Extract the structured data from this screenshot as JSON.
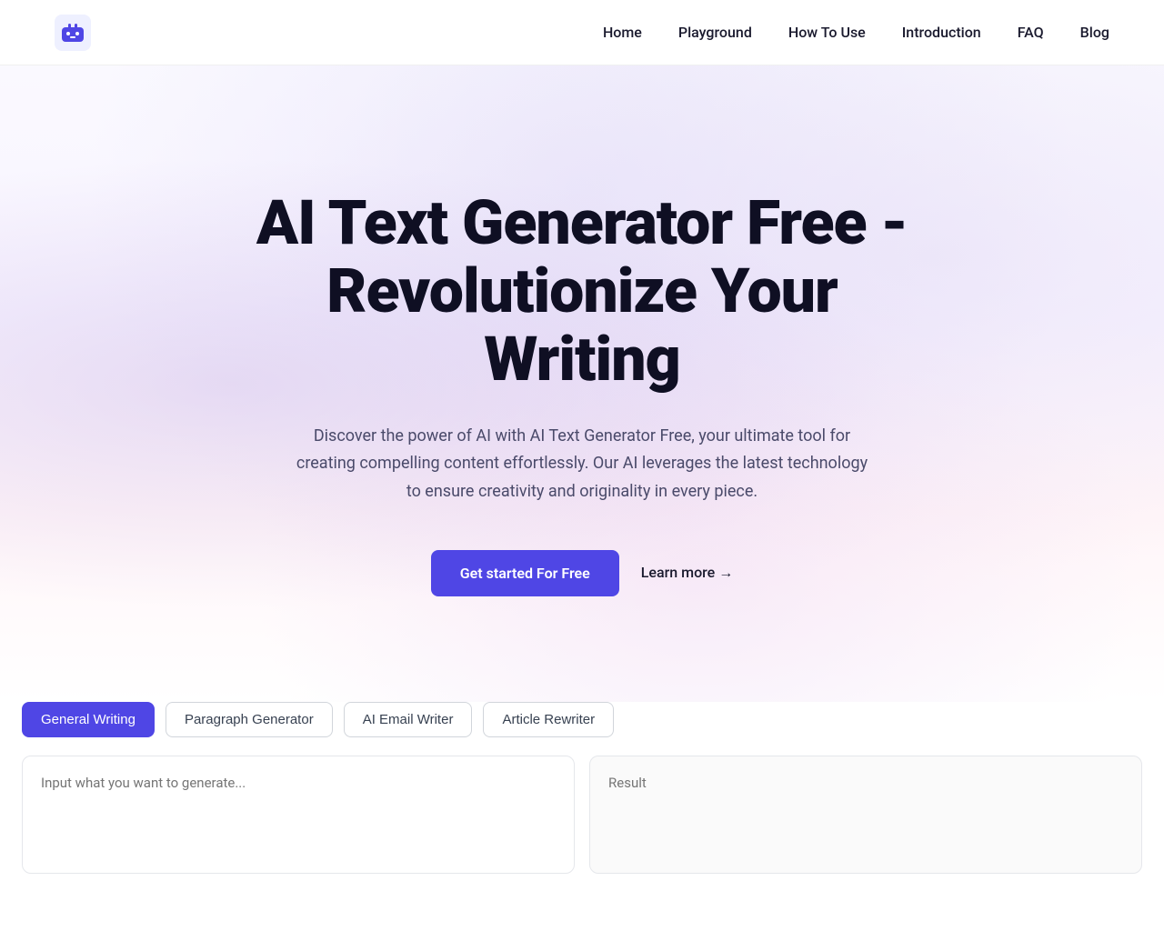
{
  "nav": {
    "links": [
      {
        "label": "Home",
        "id": "home"
      },
      {
        "label": "Playground",
        "id": "playground"
      },
      {
        "label": "How To Use",
        "id": "how-to-use"
      },
      {
        "label": "Introduction",
        "id": "introduction"
      },
      {
        "label": "FAQ",
        "id": "faq"
      },
      {
        "label": "Blog",
        "id": "blog"
      }
    ]
  },
  "hero": {
    "title": "AI Text Generator Free - Revolutionize Your Writing",
    "description": "Discover the power of AI with AI Text Generator Free, your ultimate tool for creating compelling content effortlessly. Our AI leverages the latest technology to ensure creativity and originality in every piece.",
    "cta_primary": "Get started For Free",
    "cta_secondary": "Learn more →"
  },
  "tools": {
    "tabs": [
      {
        "label": "General Writing",
        "id": "general-writing",
        "active": true
      },
      {
        "label": "Paragraph Generator",
        "id": "paragraph-generator",
        "active": false
      },
      {
        "label": "AI Email Writer",
        "id": "ai-email-writer",
        "active": false
      },
      {
        "label": "Article Rewriter",
        "id": "article-rewriter",
        "active": false
      }
    ],
    "input_placeholder": "Input what you want to generate...",
    "result_placeholder": "Result"
  },
  "colors": {
    "accent": "#4f46e5",
    "text_dark": "#0f0f23",
    "text_muted": "#4a4a6a"
  }
}
